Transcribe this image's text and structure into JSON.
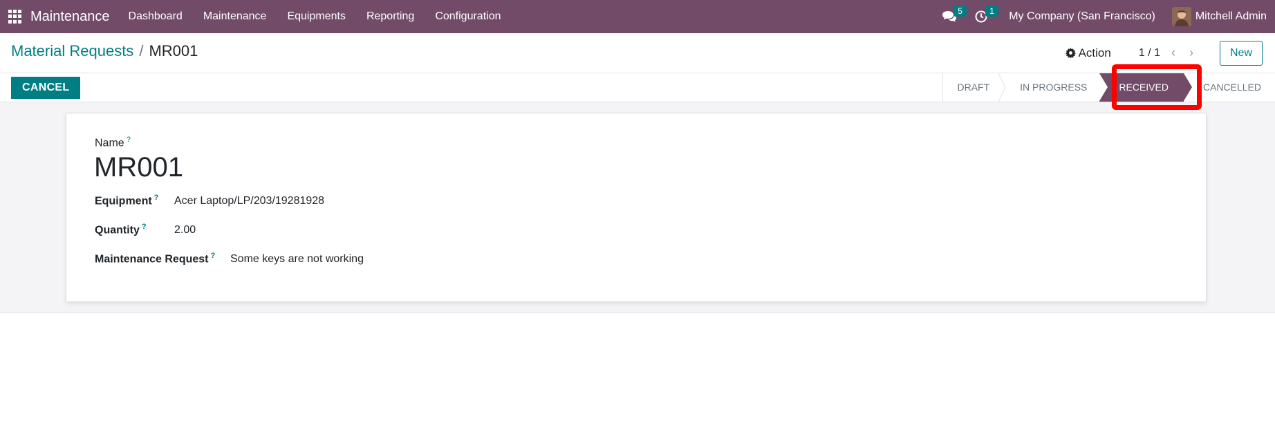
{
  "navbar": {
    "app_name": "Maintenance",
    "menu": [
      "Dashboard",
      "Maintenance",
      "Equipments",
      "Reporting",
      "Configuration"
    ],
    "messages_count": "5",
    "activities_count": "1",
    "company": "My Company (San Francisco)",
    "user": "Mitchell Admin",
    "icons": [
      "apps-grid-icon",
      "chat-icon",
      "clock-icon",
      "user-avatar"
    ]
  },
  "control_panel": {
    "breadcrumb_parent": "Material Requests",
    "breadcrumb_separator": "/",
    "breadcrumb_current": "MR001",
    "action_label": "Action",
    "pager": "1 / 1",
    "new_label": "New"
  },
  "statusbar": {
    "cancel_label": "CANCEL",
    "stages": [
      "DRAFT",
      "IN PROGRESS",
      "RECEIVED",
      "CANCELLED"
    ],
    "active_stage": "RECEIVED"
  },
  "form": {
    "name_label": "Name",
    "name_value": "MR001",
    "equipment_label": "Equipment",
    "equipment_value": "Acer Laptop/LP/203/19281928",
    "quantity_label": "Quantity",
    "quantity_value": "2.00",
    "maintenance_request_label": "Maintenance Request",
    "maintenance_request_value": "Some keys are not working",
    "help_mark": "?"
  },
  "colors": {
    "brand": "#714B67",
    "accent": "#017E84",
    "highlight": "#ff0000"
  }
}
